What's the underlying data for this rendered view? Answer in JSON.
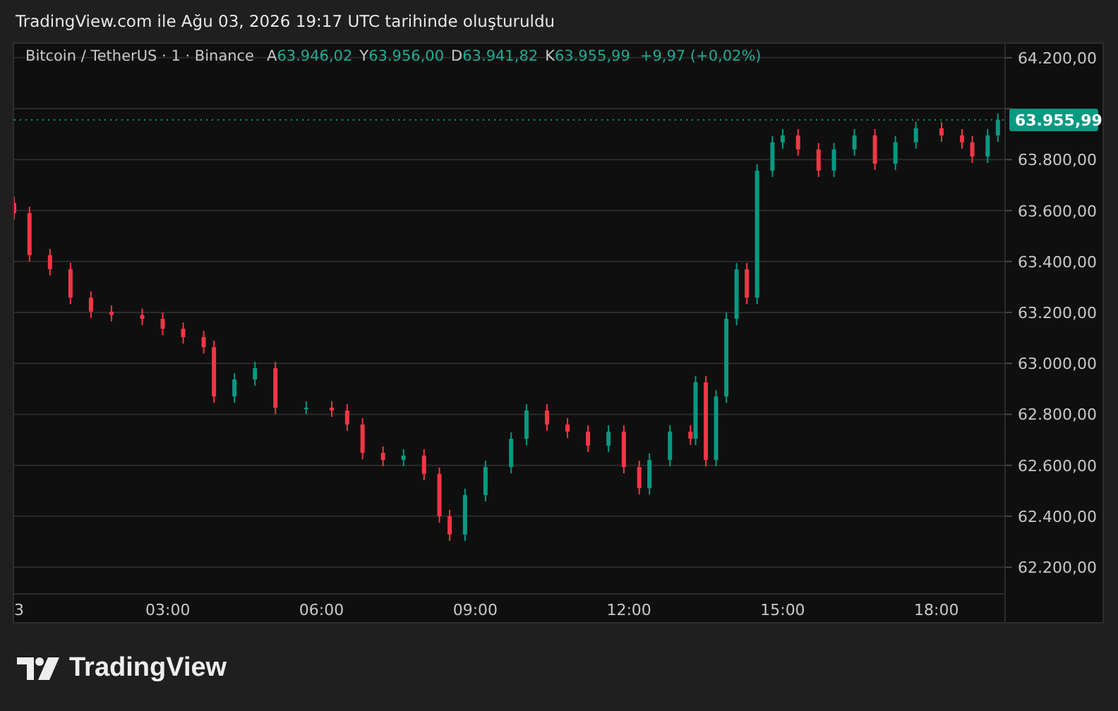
{
  "header": {
    "title": "TradingView.com ile Ağu 03, 2026 19:17 UTC tarihinde oluşturuldu"
  },
  "legend": {
    "symbol": "Bitcoin / TetherUS · 1 · Binance",
    "fields": [
      {
        "label": "A",
        "value": "63.946,02"
      },
      {
        "label": "Y",
        "value": "63.956,00"
      },
      {
        "label": "D",
        "value": "63.941,82"
      },
      {
        "label": "K",
        "value": "63.955,99"
      }
    ],
    "change": "+9,97 (+0,02%)"
  },
  "chart": {
    "day_label": "3",
    "chart_data": {
      "type": "candlestick",
      "grid": true,
      "x": [
        0,
        0.3,
        0.7,
        1.1,
        1.5,
        1.9,
        2.5,
        2.9,
        3.3,
        3.7,
        3.9,
        4.3,
        4.7,
        5.1,
        5.7,
        6.2,
        6.5,
        6.8,
        7.2,
        7.6,
        8.0,
        8.3,
        8.5,
        8.8,
        9.2,
        9.7,
        10.0,
        10.4,
        10.8,
        11.2,
        11.6,
        11.9,
        12.2,
        12.4,
        12.8,
        13.2,
        13.3,
        13.5,
        13.7,
        13.9,
        14.1,
        14.3,
        14.5,
        14.8,
        15.0,
        15.3,
        15.7,
        16.0,
        16.4,
        16.8,
        17.2,
        17.6,
        18.1,
        18.5,
        18.7,
        19.0,
        19.2
      ],
      "ohlc": [
        [
          63630,
          63655,
          63565,
          63590
        ],
        [
          63590,
          63615,
          63400,
          63425
        ],
        [
          63425,
          63450,
          63345,
          63370
        ],
        [
          63370,
          63395,
          63233,
          63258
        ],
        [
          63258,
          63283,
          63178,
          63203
        ],
        [
          63203,
          63228,
          63165,
          63190
        ],
        [
          63190,
          63215,
          63150,
          63175
        ],
        [
          63175,
          63200,
          63111,
          63136
        ],
        [
          63136,
          63161,
          63078,
          63103
        ],
        [
          63103,
          63128,
          63039,
          63064
        ],
        [
          63064,
          63089,
          62845,
          62870
        ],
        [
          62870,
          62962,
          62845,
          62937
        ],
        [
          62937,
          63006,
          62912,
          62981
        ],
        [
          62981,
          63006,
          62801,
          62826
        ],
        [
          62826,
          62851,
          62801,
          62826
        ],
        [
          62826,
          62851,
          62790,
          62815
        ],
        [
          62815,
          62840,
          62735,
          62760
        ],
        [
          62760,
          62785,
          62624,
          62649
        ],
        [
          62649,
          62674,
          62596,
          62621
        ],
        [
          62621,
          62663,
          62596,
          62638
        ],
        [
          62638,
          62663,
          62541,
          62566
        ],
        [
          62566,
          62591,
          62375,
          62400
        ],
        [
          62400,
          62425,
          62303,
          62328
        ],
        [
          62328,
          62508,
          62303,
          62483
        ],
        [
          62483,
          62618,
          62458,
          62593
        ],
        [
          62593,
          62729,
          62568,
          62704
        ],
        [
          62704,
          62840,
          62679,
          62815
        ],
        [
          62815,
          62840,
          62735,
          62760
        ],
        [
          62760,
          62785,
          62707,
          62732
        ],
        [
          62732,
          62757,
          62652,
          62677
        ],
        [
          62677,
          62757,
          62652,
          62732
        ],
        [
          62732,
          62757,
          62568,
          62593
        ],
        [
          62593,
          62618,
          62485,
          62510
        ],
        [
          62510,
          62646,
          62485,
          62621
        ],
        [
          62621,
          62757,
          62596,
          62732
        ],
        [
          62732,
          62757,
          62679,
          62704
        ],
        [
          62704,
          62951,
          62679,
          62926
        ],
        [
          62926,
          62951,
          62596,
          62621
        ],
        [
          62621,
          62895,
          62596,
          62870
        ],
        [
          62870,
          63200,
          62845,
          63175
        ],
        [
          63175,
          63394,
          63150,
          63369
        ],
        [
          63369,
          63394,
          63233,
          63258
        ],
        [
          63258,
          63782,
          63233,
          63757
        ],
        [
          63757,
          63893,
          63732,
          63868
        ],
        [
          63868,
          63920,
          63843,
          63895
        ],
        [
          63895,
          63920,
          63815,
          63840
        ],
        [
          63840,
          63865,
          63732,
          63757
        ],
        [
          63757,
          63865,
          63732,
          63840
        ],
        [
          63840,
          63920,
          63815,
          63895
        ],
        [
          63895,
          63920,
          63759,
          63784
        ],
        [
          63784,
          63893,
          63759,
          63868
        ],
        [
          63868,
          63948,
          63843,
          63923
        ],
        [
          63923,
          63948,
          63870,
          63895
        ],
        [
          63895,
          63920,
          63843,
          63868
        ],
        [
          63868,
          63893,
          63787,
          63812
        ],
        [
          63812,
          63920,
          63787,
          63895
        ],
        [
          63895,
          63981,
          63870,
          63956
        ]
      ],
      "xlim": [
        0,
        19.34
      ],
      "ylim": [
        62095,
        64255
      ],
      "xticks": [
        {
          "value": 3,
          "label": "03:00"
        },
        {
          "value": 6,
          "label": "06:00"
        },
        {
          "value": 9,
          "label": "09:00"
        },
        {
          "value": 12,
          "label": "12:00"
        },
        {
          "value": 15,
          "label": "15:00"
        },
        {
          "value": 18,
          "label": "18:00"
        }
      ],
      "yticks": [
        {
          "value": 62200,
          "label": "62.200,00"
        },
        {
          "value": 62400,
          "label": "62.400,00"
        },
        {
          "value": 62600,
          "label": "62.600,00"
        },
        {
          "value": 62800,
          "label": "62.800,00"
        },
        {
          "value": 63000,
          "label": "63.000,00"
        },
        {
          "value": 63200,
          "label": "63.200,00"
        },
        {
          "value": 63400,
          "label": "63.400,00"
        },
        {
          "value": 63600,
          "label": "63.600,00"
        },
        {
          "value": 63800,
          "label": "63.800,00"
        },
        {
          "value": 64200,
          "label": "64.200,00"
        }
      ],
      "ref_lines": [
        {
          "axis": "y",
          "value": 63955.99,
          "label": "63.955,99",
          "color": "#089981",
          "line_style": "dotted"
        }
      ]
    }
  },
  "footer": {
    "logo_text": "TradingView"
  }
}
